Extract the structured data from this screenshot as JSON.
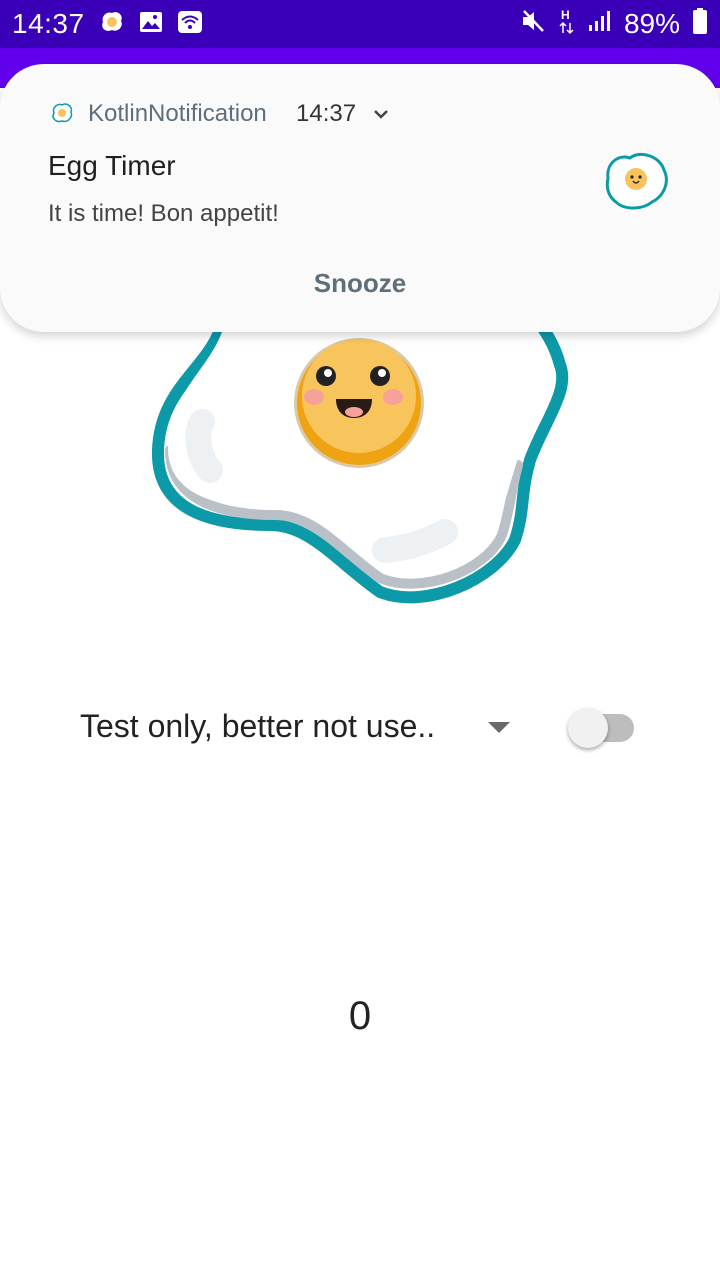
{
  "status_bar": {
    "time": "14:37",
    "battery": "89%",
    "icons": [
      "egg-notification-icon",
      "image-icon",
      "wifi-calling-icon",
      "mute-icon",
      "h-plus-data-icon",
      "signal-icon",
      "battery-icon"
    ]
  },
  "notification": {
    "app_name": "KotlinNotification",
    "time": "14:37",
    "title": "Egg Timer",
    "text": "It is time! Bon appetit!",
    "action": "Snooze",
    "icons": [
      "egg-small-icon",
      "chevron-down-icon",
      "egg-large-icon"
    ]
  },
  "main": {
    "spinner_selected": "Test only, better not use..",
    "switch_on": false,
    "timer_value": "0"
  },
  "colors": {
    "status_bar": "#3a00b8",
    "app_bar": "#6200ee",
    "egg_outline": "#0d9aa8",
    "yolk": "#f7c35a",
    "notification_bg": "#fafafa"
  }
}
